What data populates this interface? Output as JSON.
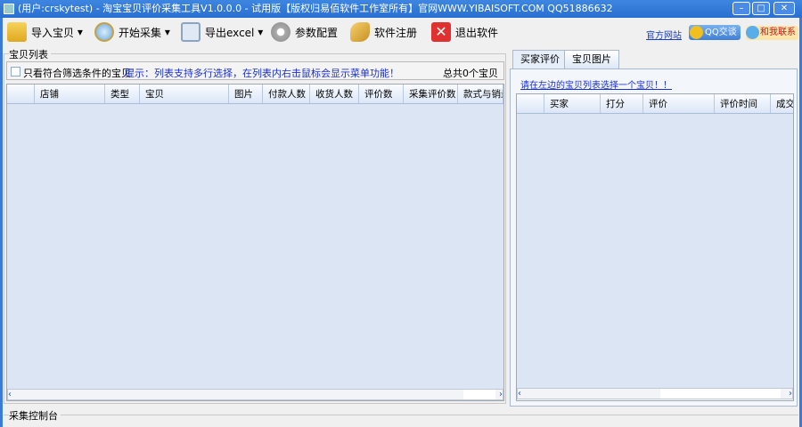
{
  "window": {
    "title": "(用户:crskytest) - 淘宝宝贝评价采集工具V1.0.0.0 - 试用版【版权归易佰软件工作室所有】官网WWW.YIBAISOFT.COM QQ51886632",
    "minimize": "–",
    "maximize": "□",
    "close": "✕"
  },
  "toolbar": [
    {
      "label": "导入宝贝",
      "icon": "folder-import-icon",
      "dropdown": "▾"
    },
    {
      "label": "开始采集",
      "icon": "magnifier-icon",
      "dropdown": "▾"
    },
    {
      "label": "导出excel",
      "icon": "save-icon",
      "dropdown": "▾"
    },
    {
      "label": "参数配置",
      "icon": "gear-icon"
    },
    {
      "label": "软件注册",
      "icon": "key-icon"
    },
    {
      "label": "退出软件",
      "icon": "close-icon"
    }
  ],
  "links": {
    "website": "官方网站",
    "qq": "QQ交谈",
    "contact": "和我联系"
  },
  "left": {
    "group_title": "宝贝列表",
    "filter_label": "只看符合筛选条件的宝贝",
    "hint": "提示：列表支持多行选择，在列表内右击鼠标会显示菜单功能！",
    "total": "总共0个宝贝",
    "columns": [
      "店铺",
      "类型",
      "宝贝",
      "图片",
      "付款人数",
      "收货人数",
      "评价数",
      "采集评价数",
      "款式与销量"
    ]
  },
  "right": {
    "tabs": [
      "买家评价",
      "宝贝图片"
    ],
    "prompt": "请在左边的宝贝列表选择一个宝贝！！",
    "columns": [
      "买家",
      "打分",
      "评价",
      "评价时间",
      "成交"
    ]
  },
  "console": {
    "title": "采集控制台"
  },
  "scroll": {
    "left": "‹",
    "right": "›"
  }
}
